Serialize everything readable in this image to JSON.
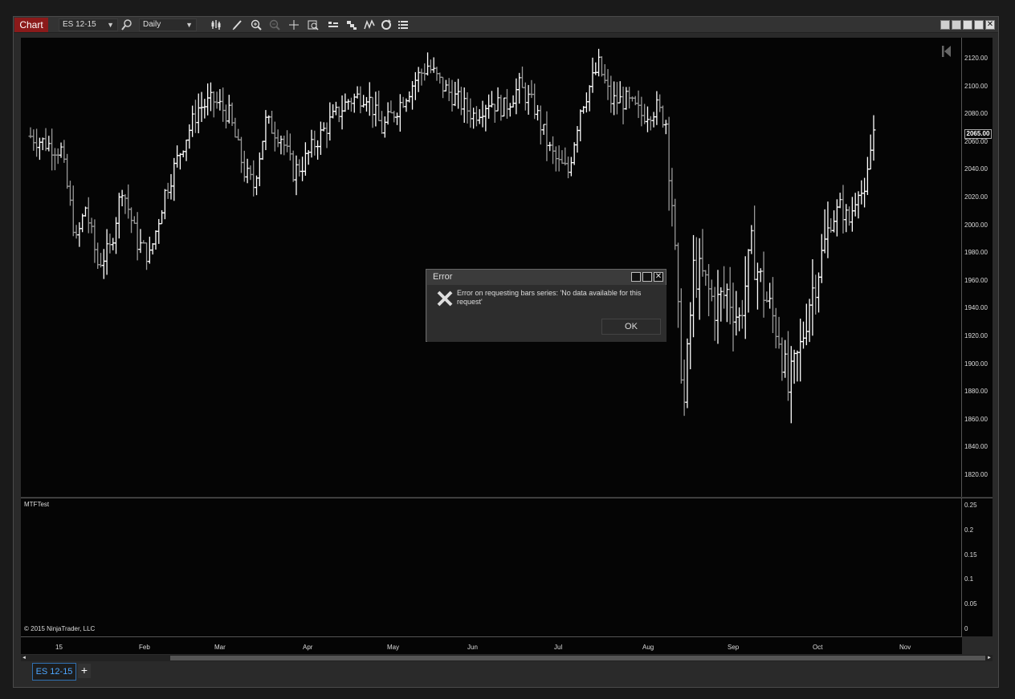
{
  "toolbar": {
    "window_tab": "Chart",
    "instrument": "ES 12-15",
    "interval": "Daily",
    "icons": [
      "search-icon",
      "bar-type-icon",
      "draw-tool-icon",
      "zoom-in-icon",
      "zoom-out-icon",
      "crosshair-icon",
      "data-box-icon",
      "chart-trader-icon",
      "strategies-icon",
      "indicators-icon",
      "reload-icon",
      "properties-icon"
    ]
  },
  "chart": {
    "current_price": "2065.00",
    "price_axis": [
      "2120.00",
      "2100.00",
      "2080.00",
      "2060.00",
      "2040.00",
      "2020.00",
      "2000.00",
      "1980.00",
      "1960.00",
      "1940.00",
      "1920.00",
      "1900.00",
      "1880.00",
      "1860.00",
      "1840.00",
      "1820.00"
    ],
    "indicator": {
      "title": "MTFTest",
      "axis": [
        "0.25",
        "0.2",
        "0.15",
        "0.1",
        "0.05",
        "0"
      ],
      "copyright": "© 2015 NinjaTrader, LLC"
    },
    "time_axis": [
      "15",
      "Feb",
      "Mar",
      "Apr",
      "May",
      "Jun",
      "Jul",
      "Aug",
      "Sep",
      "Oct",
      "Nov"
    ],
    "colors": {
      "up_bar": "#ffffff",
      "down_bar": "#999999",
      "background": "#050505"
    }
  },
  "chart_data": {
    "type": "ohlc",
    "ylim": [
      1810,
      2125
    ],
    "anchors": [
      [
        0,
        2060
      ],
      [
        10,
        2050
      ],
      [
        15,
        1985
      ],
      [
        18,
        2010
      ],
      [
        22,
        1970
      ],
      [
        26,
        1980
      ],
      [
        30,
        2025
      ],
      [
        35,
        1985
      ],
      [
        39,
        1975
      ],
      [
        44,
        2020
      ],
      [
        50,
        2055
      ],
      [
        55,
        2080
      ],
      [
        60,
        2085
      ],
      [
        65,
        2075
      ],
      [
        70,
        2035
      ],
      [
        73,
        2025
      ],
      [
        77,
        2070
      ],
      [
        82,
        2060
      ],
      [
        86,
        2035
      ],
      [
        89,
        2040
      ],
      [
        93,
        2055
      ],
      [
        98,
        2070
      ],
      [
        104,
        2085
      ],
      [
        110,
        2090
      ],
      [
        115,
        2065
      ],
      [
        120,
        2080
      ],
      [
        126,
        2100
      ],
      [
        130,
        2110
      ],
      [
        135,
        2095
      ],
      [
        140,
        2085
      ],
      [
        145,
        2075
      ],
      [
        150,
        2085
      ],
      [
        155,
        2080
      ],
      [
        160,
        2095
      ],
      [
        165,
        2080
      ],
      [
        170,
        2050
      ],
      [
        173,
        2040
      ],
      [
        176,
        2035
      ],
      [
        180,
        2080
      ],
      [
        184,
        2100
      ],
      [
        186,
        2110
      ],
      [
        190,
        2085
      ],
      [
        195,
        2085
      ],
      [
        200,
        2075
      ],
      [
        205,
        2080
      ],
      [
        208,
        2070
      ],
      [
        210,
        2015
      ],
      [
        212,
        1930
      ],
      [
        214,
        1870
      ],
      [
        217,
        1965
      ],
      [
        220,
        1960
      ],
      [
        224,
        1940
      ],
      [
        228,
        1950
      ],
      [
        232,
        1930
      ],
      [
        236,
        1980
      ],
      [
        240,
        1950
      ],
      [
        245,
        1920
      ],
      [
        248,
        1880
      ],
      [
        252,
        1910
      ],
      [
        255,
        1945
      ],
      [
        259,
        1975
      ],
      [
        262,
        2000
      ],
      [
        265,
        2010
      ],
      [
        268,
        2000
      ],
      [
        271,
        2025
      ],
      [
        273,
        2015
      ],
      [
        275,
        2050
      ],
      [
        276,
        2065
      ]
    ],
    "bars": 277
  },
  "scrollbar": {
    "left": "◄",
    "right": "►"
  },
  "tabs": {
    "series_tab": "ES 12-15",
    "add": "+"
  },
  "dialog": {
    "title": "Error",
    "message": "Error on requesting bars series: 'No data available for this request'",
    "ok_label": "OK"
  }
}
